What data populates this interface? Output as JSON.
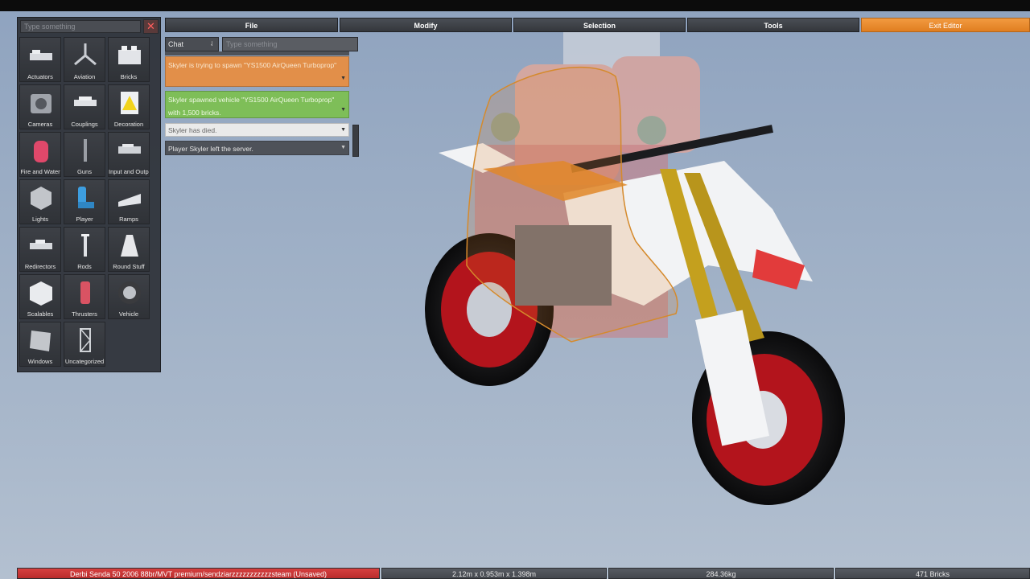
{
  "menu": {
    "file": "File",
    "modify": "Modify",
    "selection": "Selection",
    "tools": "Tools",
    "exit": "Exit Editor"
  },
  "brick_panel": {
    "search_placeholder": "Type something",
    "close_icon": "close-icon",
    "categories": [
      {
        "label": "Actuators",
        "icon": "actuator-icon"
      },
      {
        "label": "Aviation",
        "icon": "propeller-icon"
      },
      {
        "label": "Bricks",
        "icon": "brick-icon"
      },
      {
        "label": "Cameras",
        "icon": "camera-icon"
      },
      {
        "label": "Couplings",
        "icon": "coupling-icon"
      },
      {
        "label": "Decoration",
        "icon": "warning-sign-icon"
      },
      {
        "label": "Fire and Water",
        "icon": "fire-extinguisher-icon"
      },
      {
        "label": "Guns",
        "icon": "gun-icon"
      },
      {
        "label": "Input and Output",
        "icon": "io-icon"
      },
      {
        "label": "Lights",
        "icon": "light-icon"
      },
      {
        "label": "Player",
        "icon": "seat-icon"
      },
      {
        "label": "Ramps",
        "icon": "ramp-icon"
      },
      {
        "label": "Redirectors",
        "icon": "redirector-icon"
      },
      {
        "label": "Rods",
        "icon": "rod-icon"
      },
      {
        "label": "Round Stuff",
        "icon": "cone-icon"
      },
      {
        "label": "Scalables",
        "icon": "cube-icon"
      },
      {
        "label": "Thrusters",
        "icon": "thruster-icon"
      },
      {
        "label": "Vehicle",
        "icon": "wheel-icon"
      },
      {
        "label": "Windows",
        "icon": "window-icon"
      },
      {
        "label": "Uncategorized",
        "icon": "truss-icon"
      }
    ]
  },
  "chat": {
    "channel": "Chat",
    "input_placeholder": "Type something",
    "messages": [
      {
        "text": "Skyler is trying to spawn \"YS1500 AirQueen Turboprop\"",
        "color": "#e28f49"
      },
      {
        "text": "Skyler spawned vehicle \"YS1500 AirQueen Turboprop\" with 1,500 bricks.",
        "color": "#7ebe58"
      },
      {
        "text": "Skyler has died.",
        "color": "#eaeaea"
      },
      {
        "text": "Player Skyler left the server.",
        "color": "#4e5259"
      }
    ]
  },
  "status": {
    "vehicle_name": "Derbi Senda 50 2006 88br/MVT premium/sendziarzzzzzzzzzzzsteam (Unsaved)",
    "dimensions": "2.12m x 0.953m x 1.398m",
    "mass": "284.36kg",
    "bricks": "471 Bricks"
  },
  "colors": {
    "exit_accent": "#e98a2d",
    "status_name": "#c83535",
    "sky": "#9fb0c6"
  }
}
